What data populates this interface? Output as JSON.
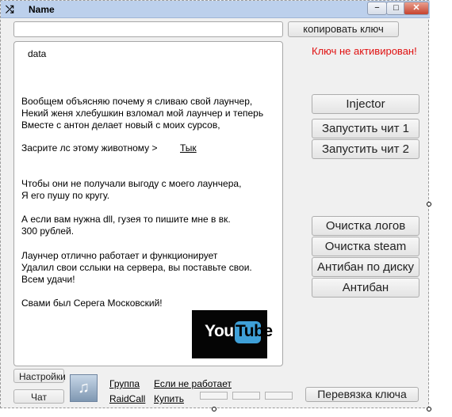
{
  "window": {
    "title": "Name",
    "title_icon": "shuffle-icon",
    "minimize": "−",
    "maximize": "□",
    "close": "✕"
  },
  "key_input": {
    "value": ""
  },
  "copy_key_label": "копировать ключ",
  "key_status": "Ключ не активирован!",
  "content": {
    "title": "data",
    "paragraphs": [
      [
        "Вообщем объясняю почему я сливаю свой лаунчер,",
        "Некий женя хлебушкин взломал мой лаунчер и теперь",
        "Вместе с антон делает новый с моих сурсов,"
      ],
      [
        "Засрите лс этому животному >"
      ],
      [
        "Чтобы они не получали выгоду с моего лаунчера,",
        "Я его пушу по кругу."
      ],
      [
        "А если вам нужна dll, гузея то пишите мне в вк.",
        "300 рублей."
      ],
      [
        "Лаунчер отлично работает и функционирует",
        "Удалил свои сслыки на сервера, вы поставьте свои.",
        "Всем удачи!"
      ],
      [
        "Свами был Серега Московский!"
      ]
    ],
    "link_label": "Тык",
    "youtube": {
      "you": "You",
      "tube": "Tube"
    }
  },
  "buttons": {
    "injector": "Injector",
    "run_cheat_1": "Запустить чит 1",
    "run_cheat_2": "Запустить чит 2",
    "clear_logs": "Очистка логов",
    "clear_steam": "Очистка steam",
    "antiban_disk": "Антибан по диску",
    "antiban": "Антибан",
    "settings": "Настройки",
    "chat": "Чат",
    "bind_key": "Перевязка ключа"
  },
  "links": {
    "group": "Группа",
    "raidcall": "RaidCall",
    "not_working": "Если не работает",
    "buy": "Купить"
  },
  "colors": {
    "status_red": "#e01010",
    "titlebar": "#bcd0ec",
    "youtube_blue": "#3fa0d8"
  }
}
